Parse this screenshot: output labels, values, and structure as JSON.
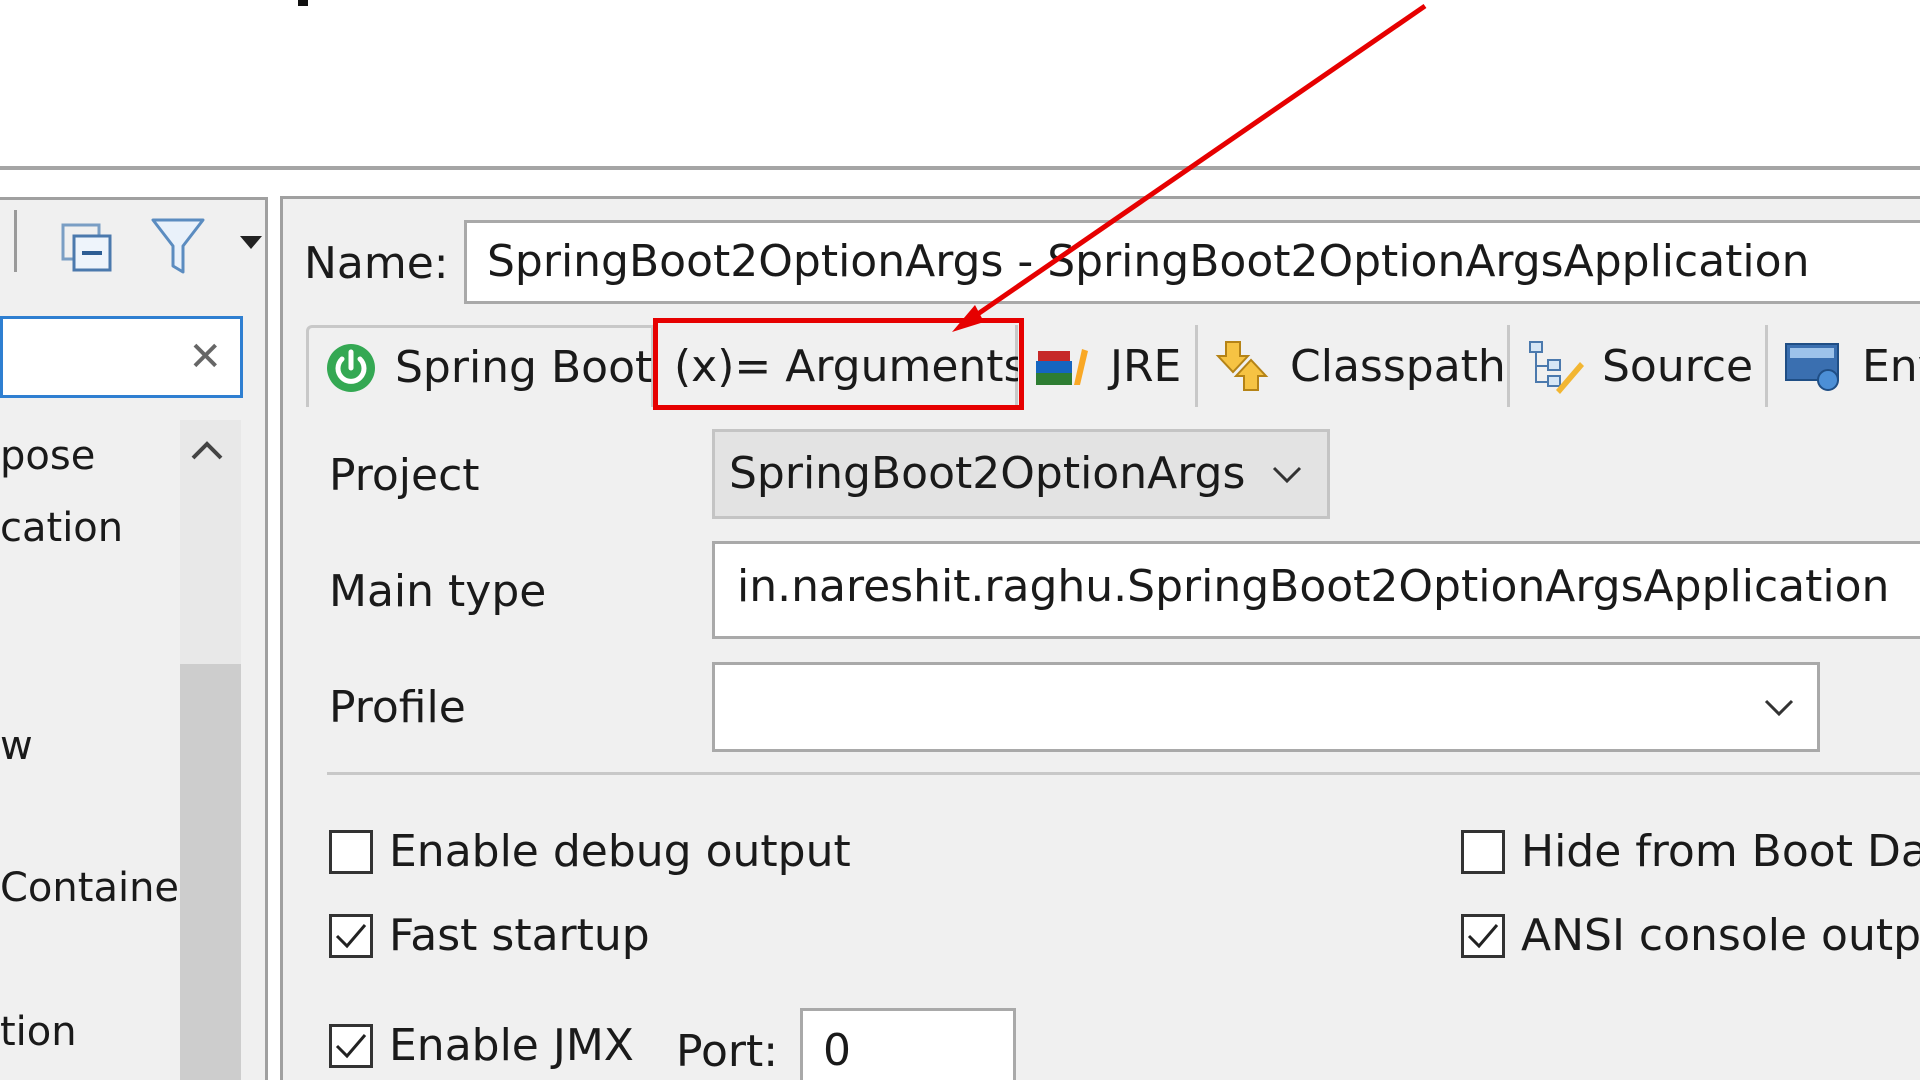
{
  "left_panel": {
    "filter_clear_icon": "close-icon",
    "tree_items": [
      "pose",
      "cation",
      "w",
      "Containe",
      "tion"
    ]
  },
  "launch_config": {
    "name_label": "Name:",
    "name_value": "SpringBoot2OptionArgs - SpringBoot2OptionArgsApplication",
    "tabs": [
      {
        "label": "Spring Boot",
        "icon": "spring-power-icon"
      },
      {
        "label": "(x)= Arguments",
        "icon": "arguments-icon"
      },
      {
        "label": "JRE",
        "icon": "jre-books-icon"
      },
      {
        "label": "Classpath",
        "icon": "classpath-icon"
      },
      {
        "label": "Source",
        "icon": "source-icon"
      },
      {
        "label": "Env",
        "icon": "environment-icon"
      }
    ],
    "project_label": "Project",
    "project_value": "SpringBoot2OptionArgs",
    "main_type_label": "Main type",
    "main_type_value": "in.nareshit.raghu.SpringBoot2OptionArgsApplication",
    "profile_label": "Profile",
    "profile_value": "",
    "checkboxes": {
      "enable_debug": {
        "label": "Enable debug output",
        "checked": false
      },
      "hide_from_boot": {
        "label": "Hide from Boot Da",
        "checked": false
      },
      "fast_startup": {
        "label": "Fast startup",
        "checked": true
      },
      "ansi_console": {
        "label": "ANSI console outp",
        "checked": true
      },
      "enable_jmx": {
        "label": "Enable JMX",
        "checked": true
      }
    },
    "port_label": "Port:",
    "port_value": "0"
  },
  "annotation": {
    "color": "#e60000"
  }
}
